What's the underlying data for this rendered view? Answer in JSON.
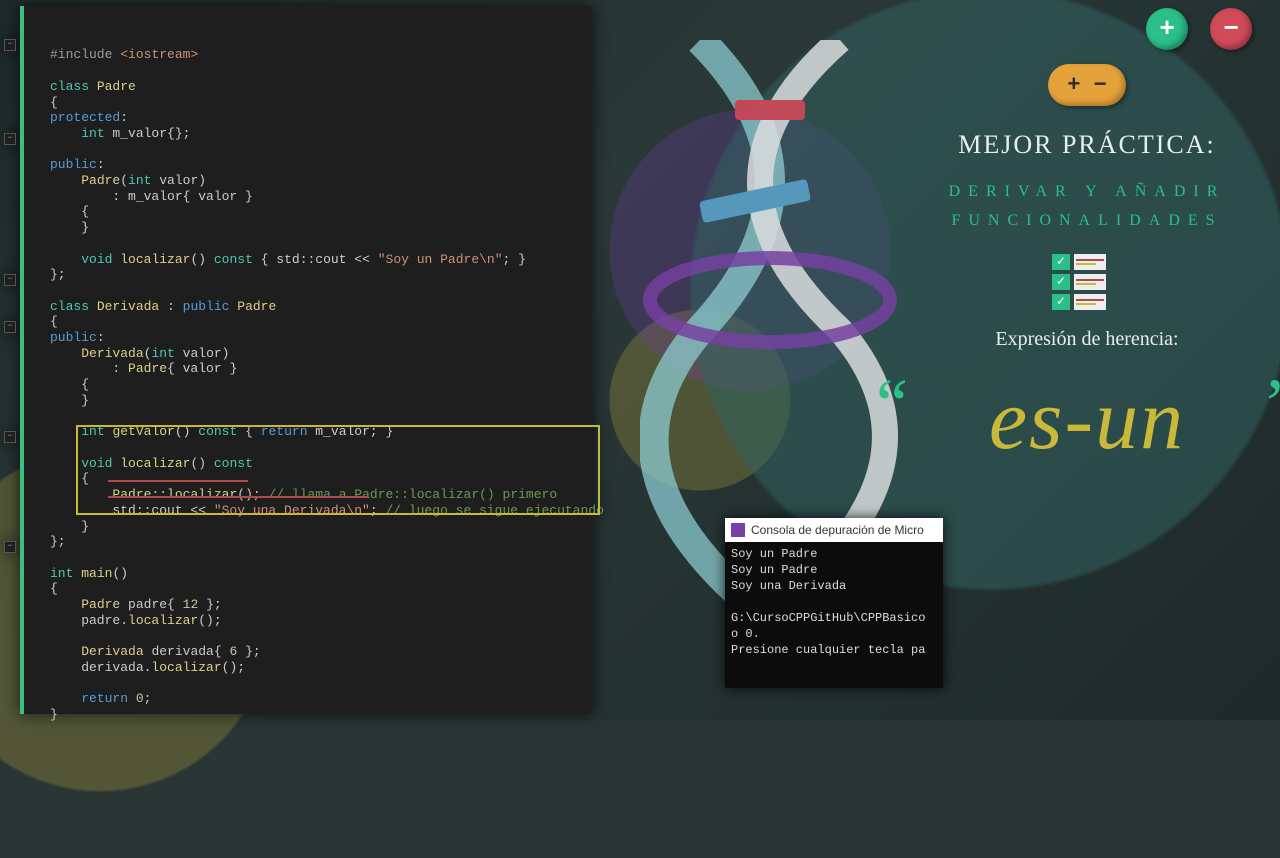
{
  "editor": {
    "code_html": "<span class='pp'>#include</span> <span class='ang'>&lt;iostream&gt;</span>\n\n<span class='kw'>class</span> <span class='id'>Padre</span>\n{\n<span class='kw2'>protected</span>:\n    <span class='kw'>int</span> m_valor{};\n\n<span class='kw2'>public</span>:\n    <span class='id'>Padre</span>(<span class='kw'>int</span> valor)\n        : m_valor{ valor }\n    {\n    }\n\n    <span class='kw'>void</span> <span class='fn'>localizar</span>() <span class='kw'>const</span> { std::cout &lt;&lt; <span class='str'>\"Soy un Padre\\n\"</span>; }\n};\n\n<span class='kw'>class</span> <span class='id'>Derivada</span> : <span class='kw2'>public</span> <span class='id'>Padre</span>\n{\n<span class='kw2'>public</span>:\n    <span class='id'>Derivada</span>(<span class='kw'>int</span> valor)\n        : <span class='id'>Padre</span>{ valor }\n    {\n    }\n\n    <span class='kw'>int</span> <span class='fn'>getValor</span>() <span class='kw'>const</span> { <span class='kw2'>return</span> m_valor; }\n\n    <span class='kw'>void</span> <span class='fn'>localizar</span>() <span class='kw'>const</span>\n    {\n        <span class='id'>Padre</span>::<span class='fn'>localizar</span>(); <span class='cmt'>// llama a Padre::localizar() primero</span>\n        std::cout &lt;&lt; <span class='str'>\"Soy una Derivada\\n\"</span>; <span class='cmt'>// luego se sigue ejecutando</span>\n    }\n};\n\n<span class='kw'>int</span> <span class='fn'>main</span>()\n{\n    <span class='id'>Padre</span> padre{ <span class='num'>12</span> };\n    padre.<span class='fn'>localizar</span>();\n\n    <span class='id'>Derivada</span> derivada{ <span class='num'>6</span> };\n    derivada.<span class='fn'>localizar</span>();\n\n    <span class='kw2'>return</span> <span class='num'>0</span>;\n}"
  },
  "info": {
    "plus": "+",
    "minus": "−",
    "combo": "+ −",
    "title": "MEJOR PRÁCTICA:",
    "line1": "DERIVAR Y AÑADIR",
    "line2": "FUNCIONALIDADES",
    "subtitle": "Expresión de herencia:",
    "quote_open": "“",
    "quote_close": "”",
    "esun": "es-un"
  },
  "console": {
    "title": "Consola de depuración de Micro",
    "lines": [
      "Soy un Padre",
      "Soy un Padre",
      "Soy una Derivada",
      "",
      "G:\\CursoCPPGitHub\\CPPBasico",
      "o 0.",
      "Presione cualquier tecla pa"
    ]
  }
}
